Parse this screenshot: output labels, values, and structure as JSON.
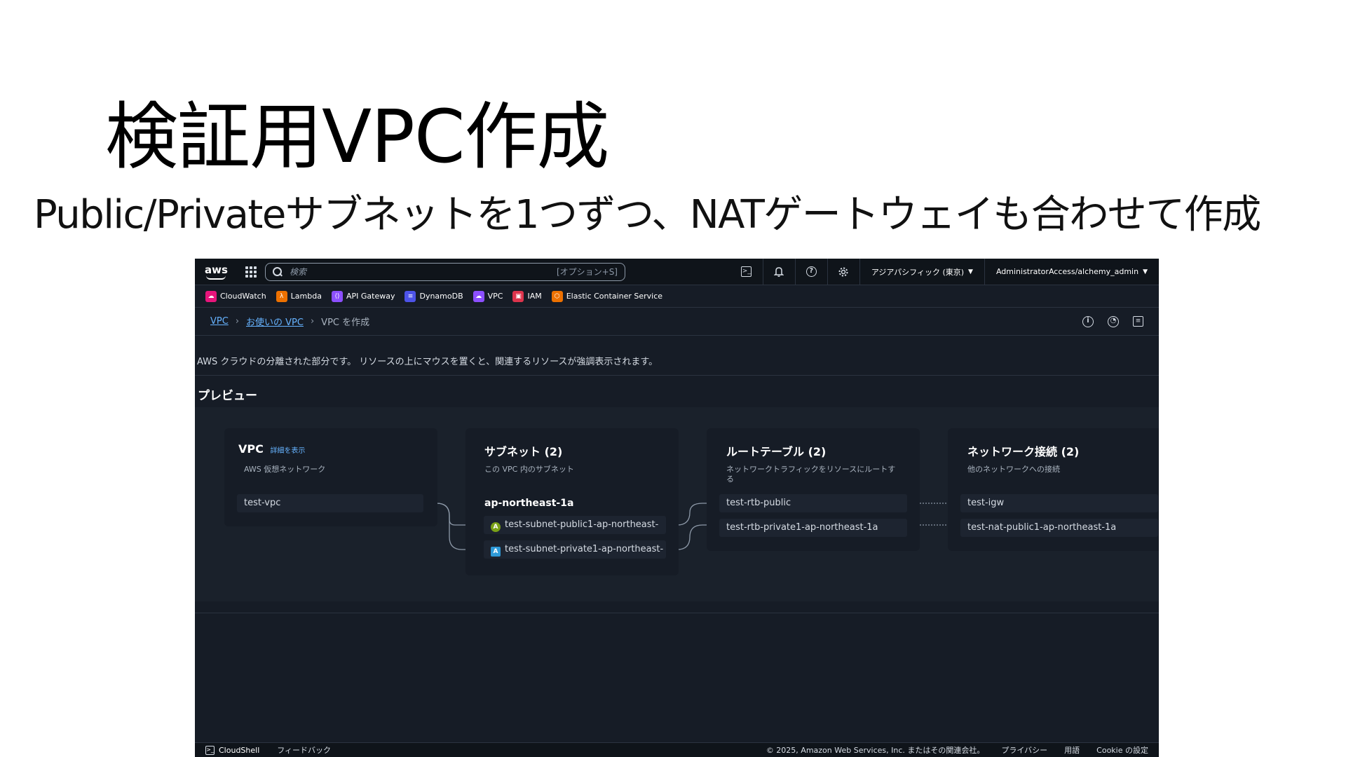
{
  "slide": {
    "title": "検証用VPC作成",
    "subtitle": "Public/Privateサブネットを1つずつ、NATゲートウェイも合わせて作成"
  },
  "topnav": {
    "logo": "aws",
    "search_placeholder": "検索",
    "search_shortcut": "[オプション+S]",
    "region": "アジアパシフィック (東京)",
    "account": "AdministratorAccess/alchemy_admin"
  },
  "favorites": [
    {
      "label": "CloudWatch",
      "color": "#e7157b",
      "icon": "cloudwatch-icon"
    },
    {
      "label": "Lambda",
      "color": "#ed7100",
      "icon": "lambda-icon"
    },
    {
      "label": "API Gateway",
      "color": "#8c4fff",
      "icon": "api-gateway-icon"
    },
    {
      "label": "DynamoDB",
      "color": "#4d53e8",
      "icon": "dynamodb-icon"
    },
    {
      "label": "VPC",
      "color": "#8c4fff",
      "icon": "vpc-icon"
    },
    {
      "label": "IAM",
      "color": "#dd344c",
      "icon": "iam-icon"
    },
    {
      "label": "Elastic Container Service",
      "color": "#ed7100",
      "icon": "ecs-icon"
    }
  ],
  "breadcrumb": {
    "root": "VPC",
    "parent": "お使いの VPC",
    "current": "VPC を作成"
  },
  "description": "AWS クラウドの分離された部分です。 リソースの上にマウスを置くと、関連するリソースが強調表示されます。",
  "preview": {
    "heading": "プレビュー",
    "vpc": {
      "title": "VPC",
      "link": "詳細を表示",
      "subtitle": "AWS 仮想ネットワーク",
      "item": "test-vpc"
    },
    "subnets": {
      "title": "サブネット (2)",
      "subtitle": "この VPC 内のサブネット",
      "az": "ap-northeast-1a",
      "items": [
        {
          "label": "test-subnet-public1-ap-northeast-",
          "badge": "A",
          "color": "#7aa116"
        },
        {
          "label": "test-subnet-private1-ap-northeast-",
          "badge": "A",
          "color": "#2e9ad8"
        }
      ]
    },
    "route_tables": {
      "title": "ルートテーブル (2)",
      "subtitle": "ネットワークトラフィックをリソースにルートする",
      "items": [
        "test-rtb-public",
        "test-rtb-private1-ap-northeast-1a"
      ]
    },
    "network": {
      "title": "ネットワーク接続 (2)",
      "subtitle": "他のネットワークへの接続",
      "items": [
        "test-igw",
        "test-nat-public1-ap-northeast-1a"
      ]
    }
  },
  "footer": {
    "cloudshell": "CloudShell",
    "feedback": "フィードバック",
    "copyright": "© 2025, Amazon Web Services, Inc. またはその関連会社。",
    "privacy": "プライバシー",
    "terms": "用語",
    "cookie": "Cookie の設定"
  }
}
